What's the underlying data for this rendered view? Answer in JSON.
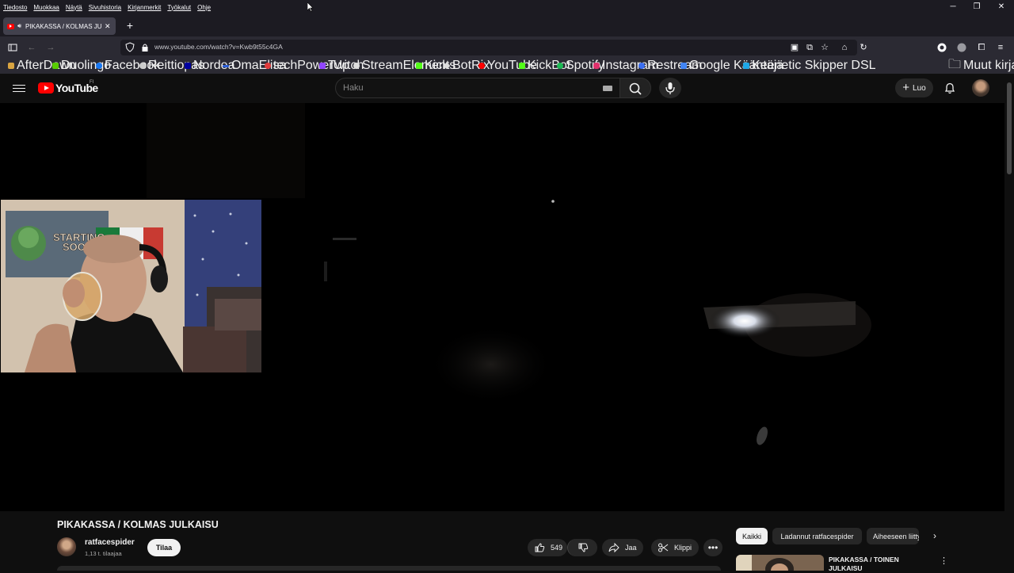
{
  "menubar": {
    "items": [
      "Tiedosto",
      "Muokkaa",
      "Näytä",
      "Sivuhistoria",
      "Kirjanmerkit",
      "Työkalut",
      "Ohje"
    ]
  },
  "tab": {
    "title": "PIKAKASSA / KOLMAS JULKAISU"
  },
  "url": "www.youtube.com/watch?v=Kwb9t55c4GA",
  "bookmarks": [
    {
      "label": "AfterDawn",
      "color": "#d9a441"
    },
    {
      "label": "Duolingo",
      "color": "#58cc02"
    },
    {
      "label": "Facebook",
      "color": "#1877f2"
    },
    {
      "label": "Reittiopas",
      "color": "#cccccc"
    },
    {
      "label": "Nordea",
      "color": "#0000a0"
    },
    {
      "label": "OmaElisa",
      "color": "#2b5fd9"
    },
    {
      "label": "techPowerUp",
      "color": "#e03a3a"
    },
    {
      "label": "Twitch",
      "color": "#9146ff"
    },
    {
      "label": "StreamElements",
      "color": "#dddddd"
    },
    {
      "label": "Kick",
      "color": "#53fc18"
    },
    {
      "label": "BotRix",
      "color": "#dddddd"
    },
    {
      "label": "YouTube",
      "color": "#ff0000"
    },
    {
      "label": "KickBot",
      "color": "#53fc18"
    },
    {
      "label": "Spotify",
      "color": "#1db954"
    },
    {
      "label": "Instagram",
      "color": "#e1306c"
    },
    {
      "label": "Restream",
      "color": "#3b6ef0"
    },
    {
      "label": "Google Kääntäjä",
      "color": "#4285f4"
    },
    {
      "label": "Keenetic Skipper DSL",
      "color": "#1ea7e8"
    }
  ],
  "other_bookmarks": "Muut kirjanmerkit",
  "youtube": {
    "wordmark": "YouTube",
    "country": "FI",
    "search_placeholder": "Haku",
    "create_label": "Luo"
  },
  "video": {
    "title": "PIKAKASSA / KOLMAS JULKAISU",
    "channel": "ratfacespider",
    "subscribers": "1,13 t. tilaajaa",
    "subscribe_label": "Tilaa",
    "likes": "549",
    "share_label": "Jaa",
    "clip_label": "Klippi"
  },
  "webcam": {
    "banner_text": "STARTING SOON"
  },
  "sidebar": {
    "chips": [
      "Kaikki",
      "Ladannut ratfacespider",
      "Aiheeseen liittyvät"
    ],
    "rec_title": "PIKAKASSA / TOINEN JULKAISU"
  },
  "colors": {
    "yt_red": "#ff0000",
    "bg": "#0f0f0f",
    "chrome": "#2b2a33"
  }
}
